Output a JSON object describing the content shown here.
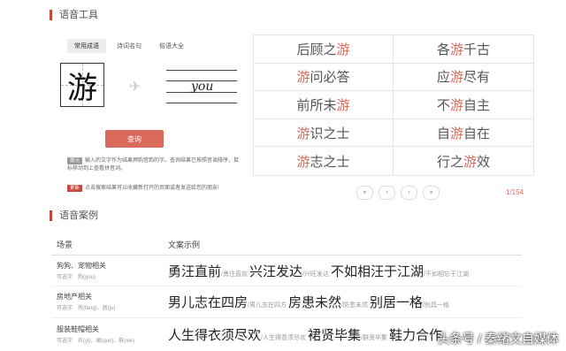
{
  "section1": {
    "title": "语音工具"
  },
  "tabs": [
    {
      "label": "常用成语"
    },
    {
      "label": "诗词名句"
    },
    {
      "label": "俗语大全"
    }
  ],
  "lookup": {
    "character": "游",
    "pinyin": "you"
  },
  "query_button": {
    "label": "查询"
  },
  "tip1": {
    "badge": "提示",
    "text": "输入的文字作为结果押韵音韵的字。查询结果已按照音调排序，鼠标移动到上查看拼音词。"
  },
  "tip2": {
    "badge": "更新",
    "text": "点击搜索结果可以收藏新打开的页面或者发送给您的朋友!"
  },
  "idioms": [
    {
      "pre": "后顾之",
      "hl": "游",
      "post": ""
    },
    {
      "pre": "各",
      "hl": "游",
      "post": "千古"
    },
    {
      "pre": "",
      "hl": "游",
      "post": "问必答"
    },
    {
      "pre": "应",
      "hl": "游",
      "post": "尽有"
    },
    {
      "pre": "前所未",
      "hl": "游",
      "post": ""
    },
    {
      "pre": "不",
      "hl": "游",
      "post": "自主"
    },
    {
      "pre": "",
      "hl": "游",
      "post": "识之士"
    },
    {
      "pre": "自",
      "hl": "游",
      "post": "自在"
    },
    {
      "pre": "",
      "hl": "游",
      "post": "志之士"
    },
    {
      "pre": "行之",
      "hl": "游",
      "post": "效"
    }
  ],
  "pager": {
    "first": "«",
    "prev": "‹",
    "next": "›",
    "last": "»",
    "count": "1/154"
  },
  "section2": {
    "title": "语音案例"
  },
  "table": {
    "col1": "场景",
    "col2": "文案示例",
    "rows": [
      {
        "name": "狗狗、宠物相关",
        "example": "可选字　狗(gou)",
        "cases": [
          {
            "pre": "勇",
            "hl": "汪",
            "post": "直前",
            "note": "/勇往直前"
          },
          {
            "pre": "兴",
            "hl": "汪",
            "post": "发达",
            "note": "/兴旺发达"
          },
          {
            "pre": "不如相",
            "hl": "汪",
            "post": "于江湖",
            "note": "/不如相忘于江湖"
          }
        ]
      },
      {
        "name": "房地产相关",
        "example": "可选字　房(fang)、居(ju)",
        "cases": [
          {
            "pre": "男儿志在四",
            "hl": "房",
            "post": "",
            "note": "/男儿志在四方"
          },
          {
            "pre": "",
            "hl": "房",
            "post": "患未然",
            "note": "/防患未然"
          },
          {
            "pre": "别",
            "hl": "居",
            "post": "一格",
            "note": "/别具一格"
          }
        ]
      },
      {
        "name": "服装鞋帽相关",
        "example": "可选字　衣(yi)、裙(qun)、鞋(xie)",
        "cases": [
          {
            "pre": "人生得",
            "hl": "衣",
            "post": "须尽欢",
            "note": "/人生得意须尽欢"
          },
          {
            "pre": "",
            "hl": "裙",
            "post": "贤毕集",
            "note": "/群贤毕集"
          },
          {
            "pre": "",
            "hl": "鞋",
            "post": "力合作",
            "note": ""
          }
        ]
      }
    ]
  },
  "watermark": "头条号 / 秦绪文自媒体"
}
